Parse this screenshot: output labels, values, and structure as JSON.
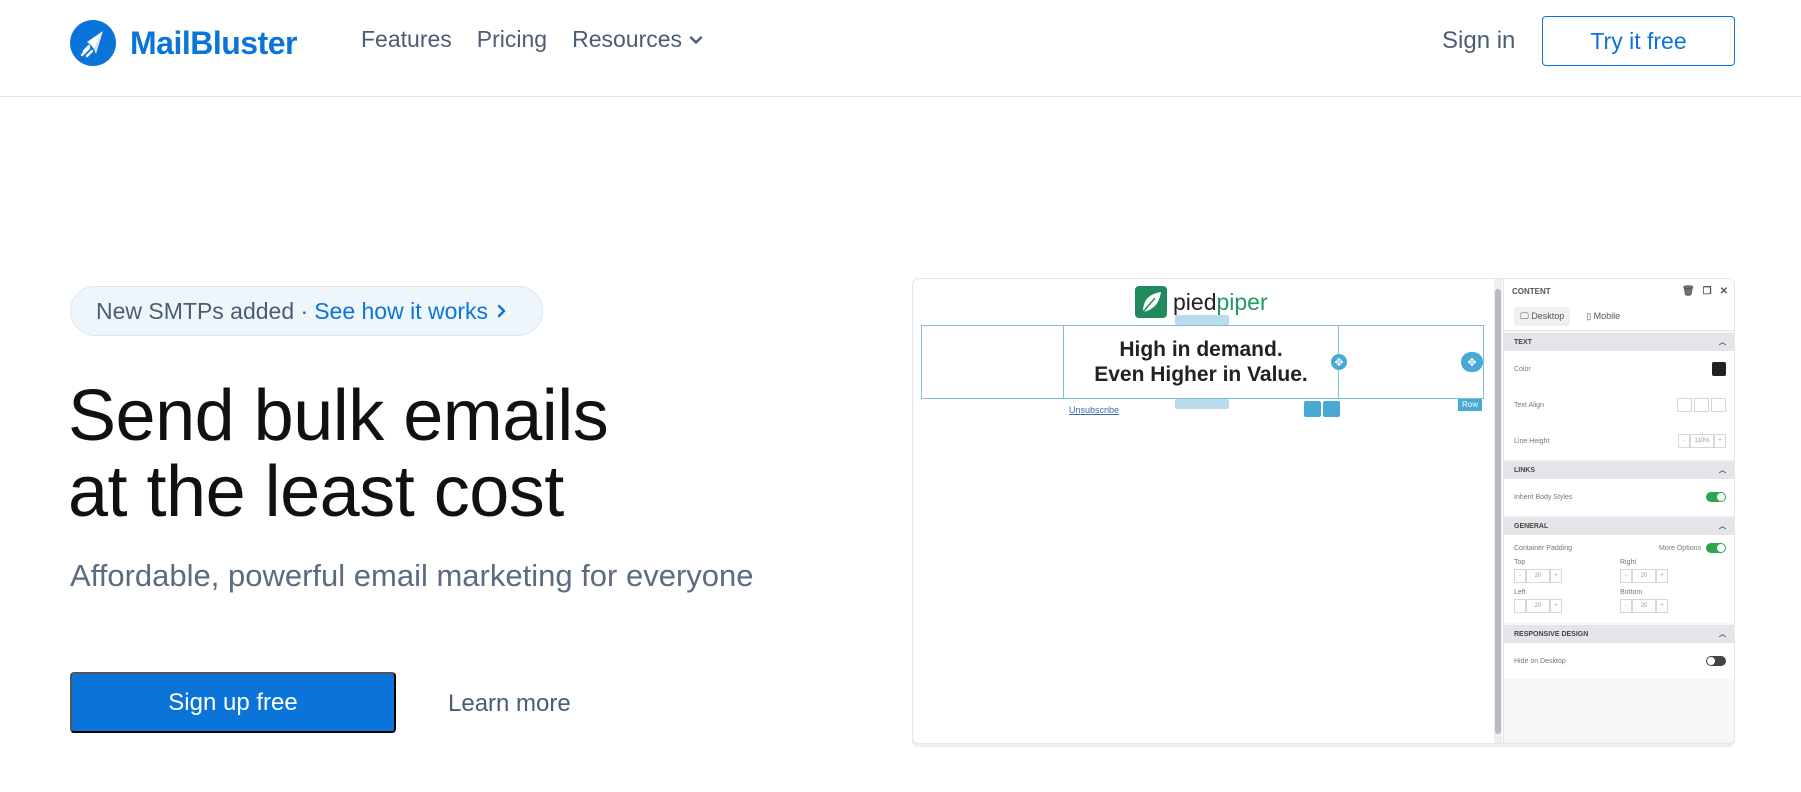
{
  "header": {
    "brand": "MailBluster",
    "nav": [
      {
        "label": "Features"
      },
      {
        "label": "Pricing"
      },
      {
        "label": "Resources"
      }
    ],
    "signin_label": "Sign in",
    "try_label": "Try it free"
  },
  "hero": {
    "announcement_text": "New SMTPs added ·",
    "announcement_link": "See how it works",
    "title_line1": "Send bulk emails",
    "title_line2": "at the least cost",
    "subtitle": "Affordable, powerful email marketing for everyone",
    "primary_cta": "Sign up free",
    "secondary_cta": "Learn more"
  },
  "preview": {
    "logo_left": "pied",
    "logo_right": "piper",
    "headline_line1": "High in demand.",
    "headline_line2": "Even Higher in Value.",
    "unsubscribe": "Unsubscribe",
    "row_tag": "Row",
    "panel": {
      "title": "CONTENT",
      "tabs": [
        "Desktop",
        "Mobile"
      ],
      "section_text": "TEXT",
      "color_label": "Color",
      "text_align_label": "Text Align",
      "line_height_label": "Line Height",
      "line_height_value": "110%",
      "section_links": "LINKS",
      "inherit_label": "Inherit Body Styles",
      "section_general": "GENERAL",
      "container_padding_label": "Container Padding",
      "more_options_label": "More Options",
      "padding": [
        {
          "label": "Top",
          "value": "20"
        },
        {
          "label": "Right",
          "value": "20"
        },
        {
          "label": "Left",
          "value": "20"
        },
        {
          "label": "Bottom",
          "value": "20"
        }
      ],
      "section_responsive": "RESPONSIVE DESIGN",
      "hide_desktop_label": "Hide on Desktop"
    }
  },
  "colors": {
    "brand_blue": "#0a74d9",
    "nav_text": "#4b5d73",
    "toggle_on": "#2da44e",
    "editor_accent": "#4aa8d4"
  }
}
